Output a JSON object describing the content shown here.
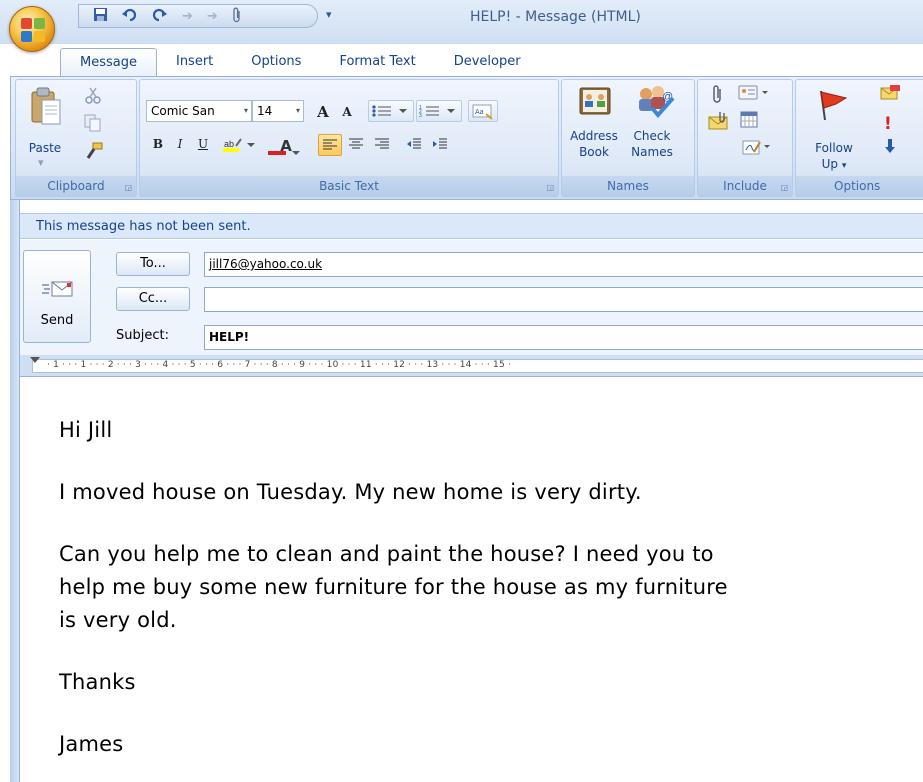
{
  "window": {
    "title": "HELP! - Message (HTML)",
    "qat_dropdown": "▾"
  },
  "icons": [
    "office-button-icon",
    "save-icon",
    "undo-icon",
    "redo-icon",
    "previous-icon",
    "next-icon",
    "attach-icon"
  ],
  "tabs": [
    "Message",
    "Insert",
    "Options",
    "Format Text",
    "Developer"
  ],
  "ribbon": {
    "clipboard": {
      "paste": "Paste",
      "label": "Clipboard"
    },
    "basic_text": {
      "font": "Comic San",
      "size": "14",
      "bold": "B",
      "italic": "I",
      "underline": "U",
      "font_color": "A",
      "grow_font": "A",
      "shrink_font": "A",
      "label": "Basic Text"
    },
    "names": {
      "address_book_1": "Address",
      "address_book_2": "Book",
      "check_names_1": "Check",
      "check_names_2": "Names",
      "label": "Names"
    },
    "include": {
      "label": "Include"
    },
    "options": {
      "follow_up_1": "Follow",
      "follow_up_2": "Up",
      "label": "Options",
      "importance": "!"
    }
  },
  "infobar": "This message has not been sent.",
  "header": {
    "send": "Send",
    "to_button": "To...",
    "cc_button": "Cc...",
    "subject_label": "Subject:",
    "to_value": "jill76@yahoo.co.uk",
    "cc_value": "",
    "subject_value": "HELP!"
  },
  "ruler": "· 1 · · · 1 · · · 2 · · · 3 · · · 4 · · · 5 · · · 6 · · · 7 · · · 8 · · · 9 · · · 10 · · · 11 · · · 12 · · · 13 · · · 14 · · · 15 ·",
  "message": {
    "line1": "Hi Jill",
    "line2": "I moved house on Tuesday. My new home is very dirty.",
    "line3": "Can you help me to clean and paint the house? I need you to",
    "line4": "help me buy some new furniture for the house as my furniture",
    "line5": "is very old.",
    "line6": "Thanks",
    "line7": "James"
  },
  "colors": {
    "accent": "#15428b",
    "ribbon": "#dfe9f7",
    "highlight_active": "#ffc85a",
    "font_color_red": "#e02020",
    "highlight_yellow": "#ffff00"
  }
}
